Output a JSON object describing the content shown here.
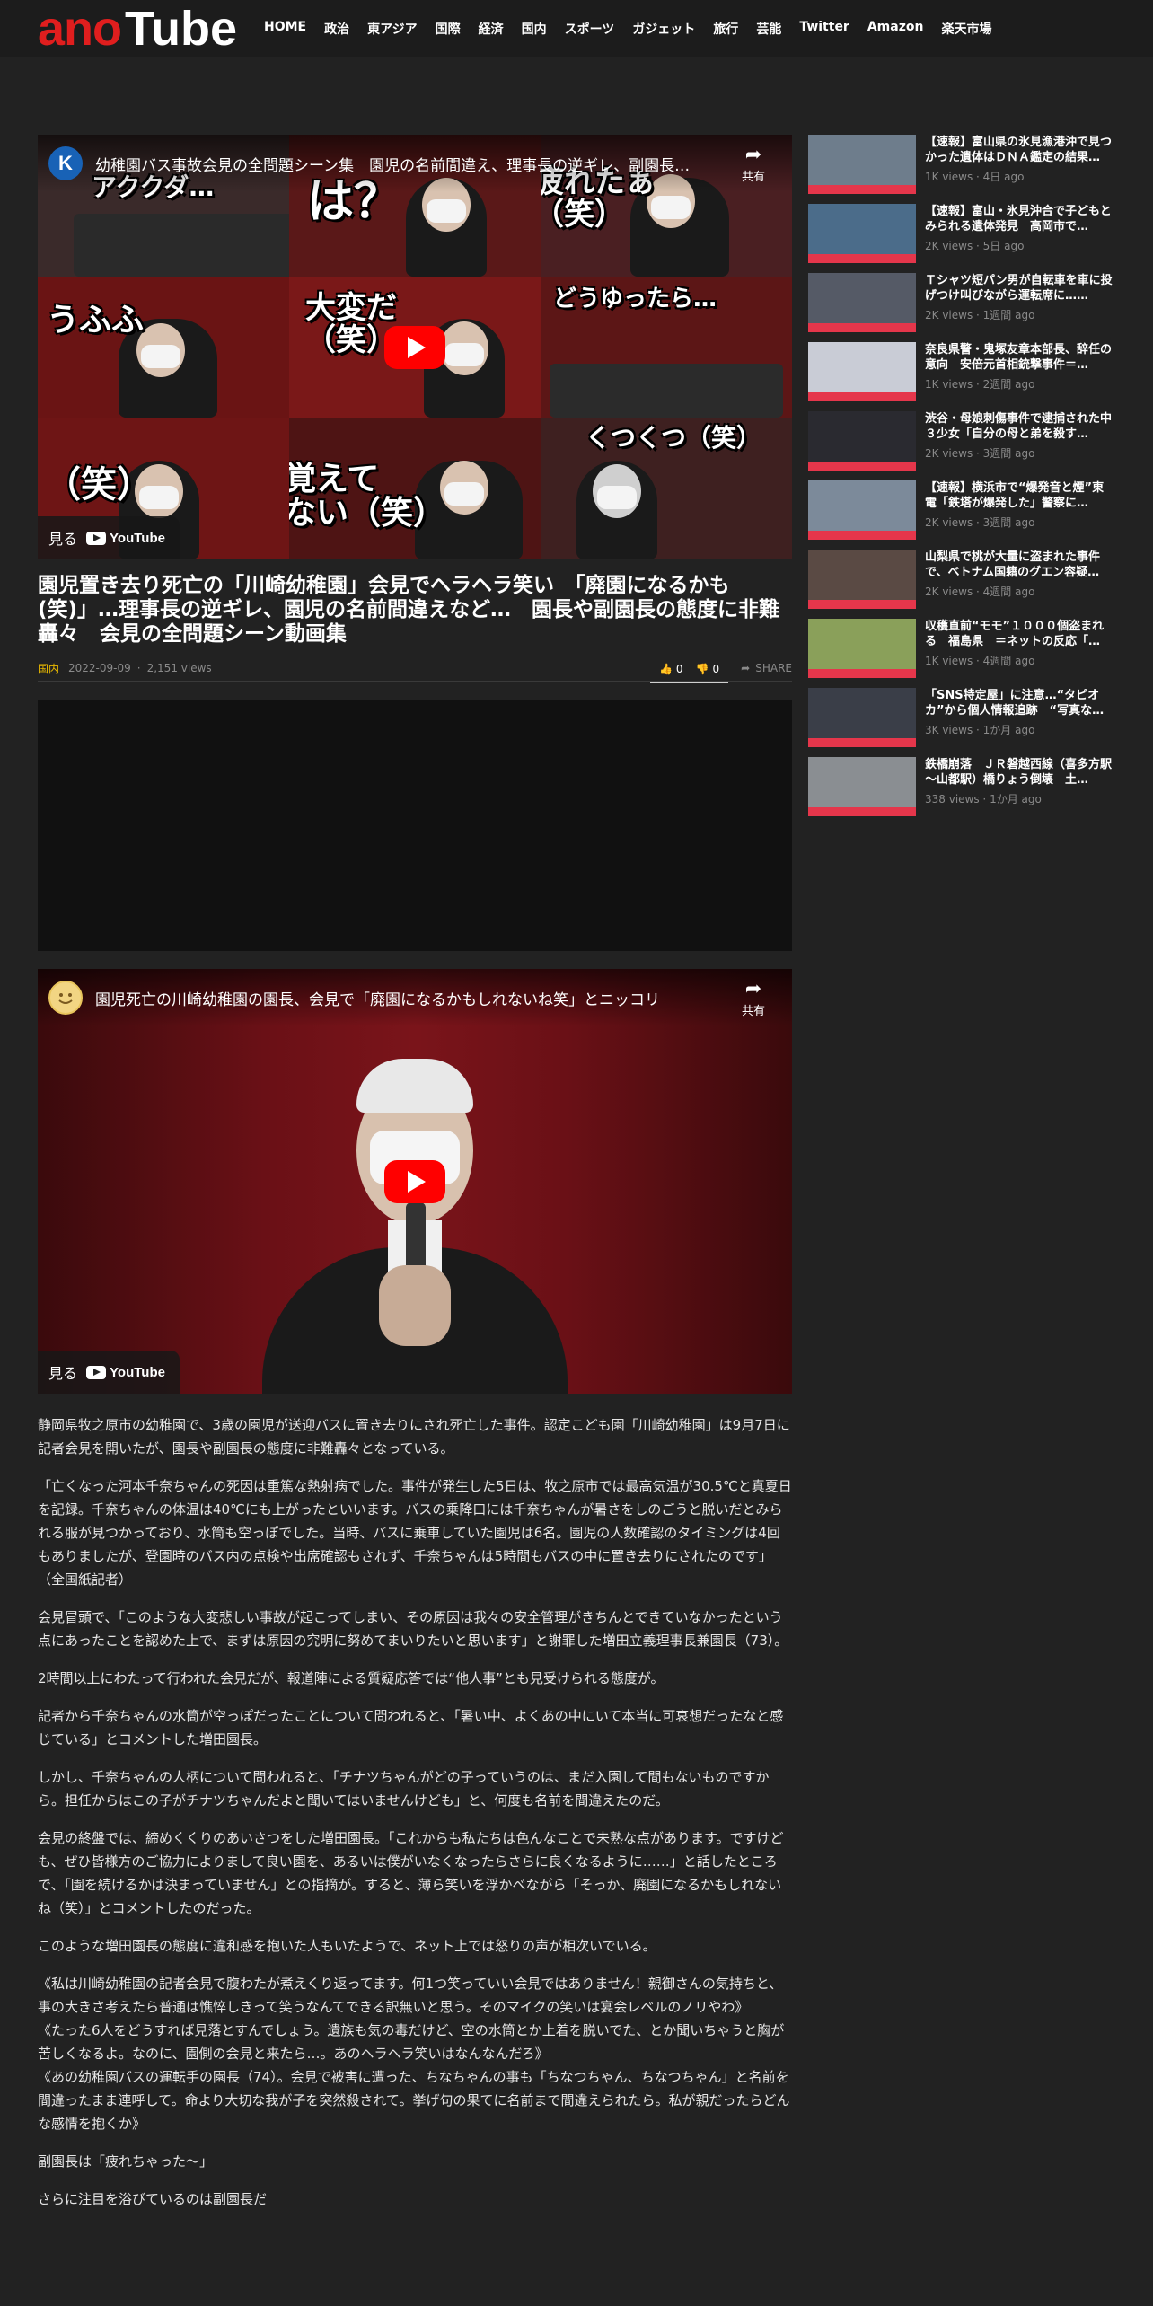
{
  "header": {
    "logo_ano": "ano",
    "logo_tube": "Tube",
    "nav": [
      "HOME",
      "政治",
      "東アジア",
      "国際",
      "経済",
      "国内",
      "スポーツ",
      "ガジェット",
      "旅行",
      "芸能",
      "Twitter",
      "Amazon",
      "楽天市場"
    ]
  },
  "video1": {
    "channel_letter": "K",
    "title": "幼稚園バス事故会見の全問題シーン集　園児の名前間違え、理事長の逆ギレ、副園長…",
    "share": "共有",
    "watch_on": "見る",
    "youtube": "YouTube",
    "captions": [
      "アククダ…",
      "は？",
      "疲れたぁ\n（笑）",
      "うふふ",
      "大変だ\n（笑）",
      "どうゆったら…",
      "（笑）",
      "覚えて\nない（笑）",
      "くつくつ（笑）"
    ]
  },
  "article": {
    "title": "園児置き去り死亡の「川崎幼稚園」会見でヘラヘラ笑い　「廃園になるかも(笑)」…理事長の逆ギレ、園児の名前間違えなど…　園長や副園長の態度に非難轟々　会見の全問題シーン動画集",
    "category": "国内",
    "date": "2022-09-09",
    "views": "2,151 views",
    "likes": "0",
    "dislikes": "0",
    "share": "SHARE"
  },
  "video2": {
    "title": "園児死亡の川崎幼稚園の園長、会見で「廃園になるかもしれないね笑」とニッコリ",
    "share": "共有",
    "watch_on": "見る",
    "youtube": "YouTube"
  },
  "body": [
    "静岡県牧之原市の幼稚園で、3歳の園児が送迎バスに置き去りにされ死亡した事件。認定こども園「川崎幼稚園」は9月7日に記者会見を開いたが、園長や副園長の態度に非難轟々となっている。",
    "「亡くなった河本千奈ちゃんの死因は重篤な熱射病でした。事件が発生した5日は、牧之原市では最高気温が30.5℃と真夏日を記録。千奈ちゃんの体温は40℃にも上がったといいます。バスの乗降口には千奈ちゃんが暑さをしのごうと脱いだとみられる服が見つかっており、水筒も空っぽでした。当時、バスに乗車していた園児は6名。園児の人数確認のタイミングは4回もありましたが、登園時のバス内の点検や出席確認もされず、千奈ちゃんは5時間もバスの中に置き去りにされたのです」（全国紙記者）",
    "会見冒頭で、「このような大変悲しい事故が起こってしまい、その原因は我々の安全管理がきちんとできていなかったという点にあったことを認めた上で、まずは原因の究明に努めてまいりたいと思います」と謝罪した増田立義理事長兼園長（73）。",
    "2時間以上にわたって行われた会見だが、報道陣による質疑応答では“他人事”とも見受けられる態度が。",
    "記者から千奈ちゃんの水筒が空っぽだったことについて問われると、「暑い中、よくあの中にいて本当に可哀想だったなと感じている」とコメントした増田園長。",
    "しかし、千奈ちゃんの人柄について問われると、「チナツちゃんがどの子っていうのは、まだ入園して間もないものですから。担任からはこの子がチナツちゃんだよと聞いてはいませんけども」と、何度も名前を間違えたのだ。",
    "会見の終盤では、締めくくりのあいさつをした増田園長。「これからも私たちは色んなことで未熟な点があります。ですけども、ぜひ皆様方のご協力によりまして良い園を、あるいは僕がいなくなったらさらに良くなるように……」と話したところで、「園を続けるかは決まっていません」との指摘が。すると、薄ら笑いを浮かべながら「そっか、廃園になるかもしれないね（笑）」とコメントしたのだった。",
    "このような増田園長の態度に違和感を抱いた人もいたようで、ネット上では怒りの声が相次いでいる。",
    "《私は川崎幼稚園の記者会見で腹わたが煮えくり返ってます。何1つ笑っていい会見ではありません！親御さんの気持ちと、事の大きさ考えたら普通は憔悴しきって笑うなんてできる訳無いと思う。そのマイクの笑いは宴会レベルのノリやわ》\n《たった6人をどうすれば見落とすんでしょう。遺族も気の毒だけど、空の水筒とか上着を脱いでた、とか聞いちゃうと胸が苦しくなるよ。なのに、園側の会見と来たら…。あのヘラヘラ笑いはなんなんだろ》\n《あの幼稚園バスの運転手の園長（74）。会見で被害に遭った、ちなちゃんの事も「ちなつちゃん、ちなつちゃん」と名前を間違ったまま連呼して。命より大切な我が子を突然殺されて。挙げ句の果てに名前まで間違えられたら。私が親だったらどんな感情を抱くか》",
    "副園長は「疲れちゃった～」",
    "さらに注目を浴びているのは副園長だ"
  ],
  "sidebar": [
    {
      "title": "【速報】富山県の氷見漁港沖で見つかった遺体はＤＮＡ鑑定の結果…",
      "views": "1K views",
      "ago": "4日 ago",
      "thumb": "#6e7d8c"
    },
    {
      "title": "【速報】富山・氷見沖合で子どもとみられる遺体発見　高岡市で…",
      "views": "2K views",
      "ago": "5日 ago",
      "thumb": "#4b6c8a"
    },
    {
      "title": "Ｔシャツ短パン男が自転車を車に投げつけ叫びながら運転席に……",
      "views": "2K views",
      "ago": "1週間 ago",
      "thumb": "#555a66"
    },
    {
      "title": "奈良県警・鬼塚友章本部長、辞任の意向　安倍元首相銃撃事件＝…",
      "views": "1K views",
      "ago": "2週間 ago",
      "thumb": "#c9ccd6"
    },
    {
      "title": "渋谷・母娘刺傷事件で逮捕された中３少女「自分の母と弟を殺す…",
      "views": "2K views",
      "ago": "3週間 ago",
      "thumb": "#2a2a30"
    },
    {
      "title": "【速報】横浜市で“爆発音と煙”東電「鉄塔が爆発した」警察に…",
      "views": "2K views",
      "ago": "3週間 ago",
      "thumb": "#7c8a9a"
    },
    {
      "title": "山梨県で桃が大量に盗まれた事件で、ベトナム国籍のグエン容疑…",
      "views": "2K views",
      "ago": "4週間 ago",
      "thumb": "#5a4a44"
    },
    {
      "title": "収穫直前“モモ”１０００個盗まれる　福島県　＝ネットの反応「…",
      "views": "1K views",
      "ago": "4週間 ago",
      "thumb": "#8aa05a"
    },
    {
      "title": "「SNS特定屋」に注意…“タピオカ”から個人情報追跡　“写真な…",
      "views": "3K views",
      "ago": "1か月 ago",
      "thumb": "#3a3e48"
    },
    {
      "title": "鉄橋崩落　ＪＲ磐越西線（喜多方駅～山都駅）橋りょう倒壊　土…",
      "views": "338 views",
      "ago": "1か月 ago",
      "thumb": "#8a8e92"
    }
  ],
  "colors": {
    "accent": "#e01e1e",
    "category": "#e8b800",
    "background": "#222222"
  }
}
